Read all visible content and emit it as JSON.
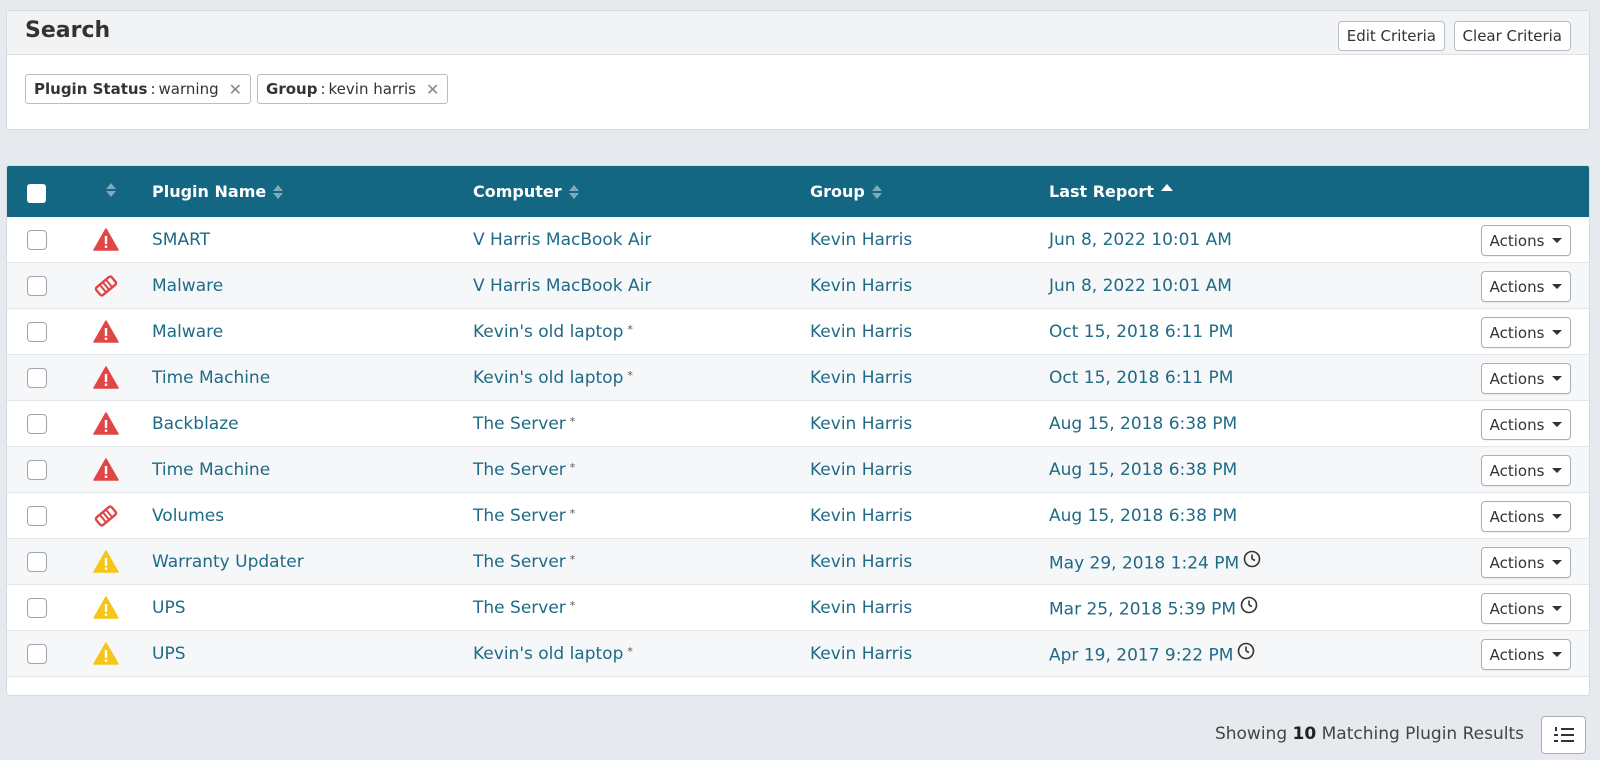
{
  "search": {
    "title": "Search",
    "edit_label": "Edit Criteria",
    "clear_label": "Clear Criteria",
    "filters": [
      {
        "key": "Plugin Status",
        "value": "warning"
      },
      {
        "key": "Group",
        "value": "kevin harris"
      }
    ],
    "separator": ":"
  },
  "table": {
    "columns": [
      "Plugin Name",
      "Computer",
      "Group",
      "Last Report"
    ],
    "sorted_column": "Last Report",
    "sort_direction": "ascending",
    "rows": [
      {
        "status": "error",
        "plugin": "SMART",
        "computer": "V Harris MacBook Air",
        "computer_flag": "",
        "group": "Kevin Harris",
        "last_report": "Jun 8, 2022 10:01 AM",
        "stale": false,
        "actions": "Actions"
      },
      {
        "status": "tag",
        "plugin": "Malware",
        "computer": "V Harris MacBook Air",
        "computer_flag": "",
        "group": "Kevin Harris",
        "last_report": "Jun 8, 2022 10:01 AM",
        "stale": false,
        "actions": "Actions"
      },
      {
        "status": "error",
        "plugin": "Malware",
        "computer": "Kevin's old laptop",
        "computer_flag": "*",
        "group": "Kevin Harris",
        "last_report": "Oct 15, 2018 6:11 PM",
        "stale": false,
        "actions": "Actions"
      },
      {
        "status": "error",
        "plugin": "Time Machine",
        "computer": "Kevin's old laptop",
        "computer_flag": "*",
        "group": "Kevin Harris",
        "last_report": "Oct 15, 2018 6:11 PM",
        "stale": false,
        "actions": "Actions"
      },
      {
        "status": "error",
        "plugin": "Backblaze",
        "computer": "The Server",
        "computer_flag": "*",
        "group": "Kevin Harris",
        "last_report": "Aug 15, 2018 6:38 PM",
        "stale": false,
        "actions": "Actions"
      },
      {
        "status": "error",
        "plugin": "Time Machine",
        "computer": "The Server",
        "computer_flag": "*",
        "group": "Kevin Harris",
        "last_report": "Aug 15, 2018 6:38 PM",
        "stale": false,
        "actions": "Actions"
      },
      {
        "status": "tag",
        "plugin": "Volumes",
        "computer": "The Server",
        "computer_flag": "*",
        "group": "Kevin Harris",
        "last_report": "Aug 15, 2018 6:38 PM",
        "stale": false,
        "actions": "Actions"
      },
      {
        "status": "warning",
        "plugin": "Warranty Updater",
        "computer": "The Server",
        "computer_flag": "*",
        "group": "Kevin Harris",
        "last_report": "May 29, 2018 1:24 PM",
        "stale": true,
        "actions": "Actions"
      },
      {
        "status": "warning",
        "plugin": "UPS",
        "computer": "The Server",
        "computer_flag": "*",
        "group": "Kevin Harris",
        "last_report": "Mar 25, 2018 5:39 PM",
        "stale": true,
        "actions": "Actions"
      },
      {
        "status": "warning",
        "plugin": "UPS",
        "computer": "Kevin's old laptop",
        "computer_flag": "*",
        "group": "Kevin Harris",
        "last_report": "Apr 19, 2017 9:22 PM",
        "stale": true,
        "actions": "Actions"
      }
    ]
  },
  "footer": {
    "prefix": "Showing",
    "count": "10",
    "suffix": "Matching Plugin Results"
  },
  "colors": {
    "header_bg": "#136782",
    "link": "#1f6a86",
    "error_red": "#e04646",
    "warning_yellow": "#f5c518"
  }
}
